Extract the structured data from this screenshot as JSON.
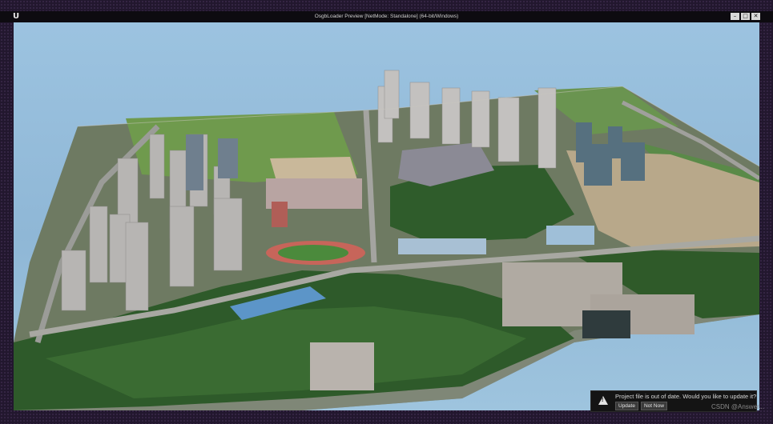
{
  "window": {
    "title": "OsgbLoader Preview [NetMode: Standalone]  (64-bit/Windows)",
    "controls": [
      "–",
      "□",
      "✕"
    ],
    "logo": "unreal-engine-logo"
  },
  "viewport": {
    "content": "3d-photogrammetry-city-model",
    "sky_color": "#9cc3e0"
  },
  "notification": {
    "message": "Project file is out of date. Would you like to update it?",
    "update_label": "Update",
    "not_now_label": "Not Now",
    "icon": "warning-icon"
  },
  "watermark": "CSDN @Answer..."
}
